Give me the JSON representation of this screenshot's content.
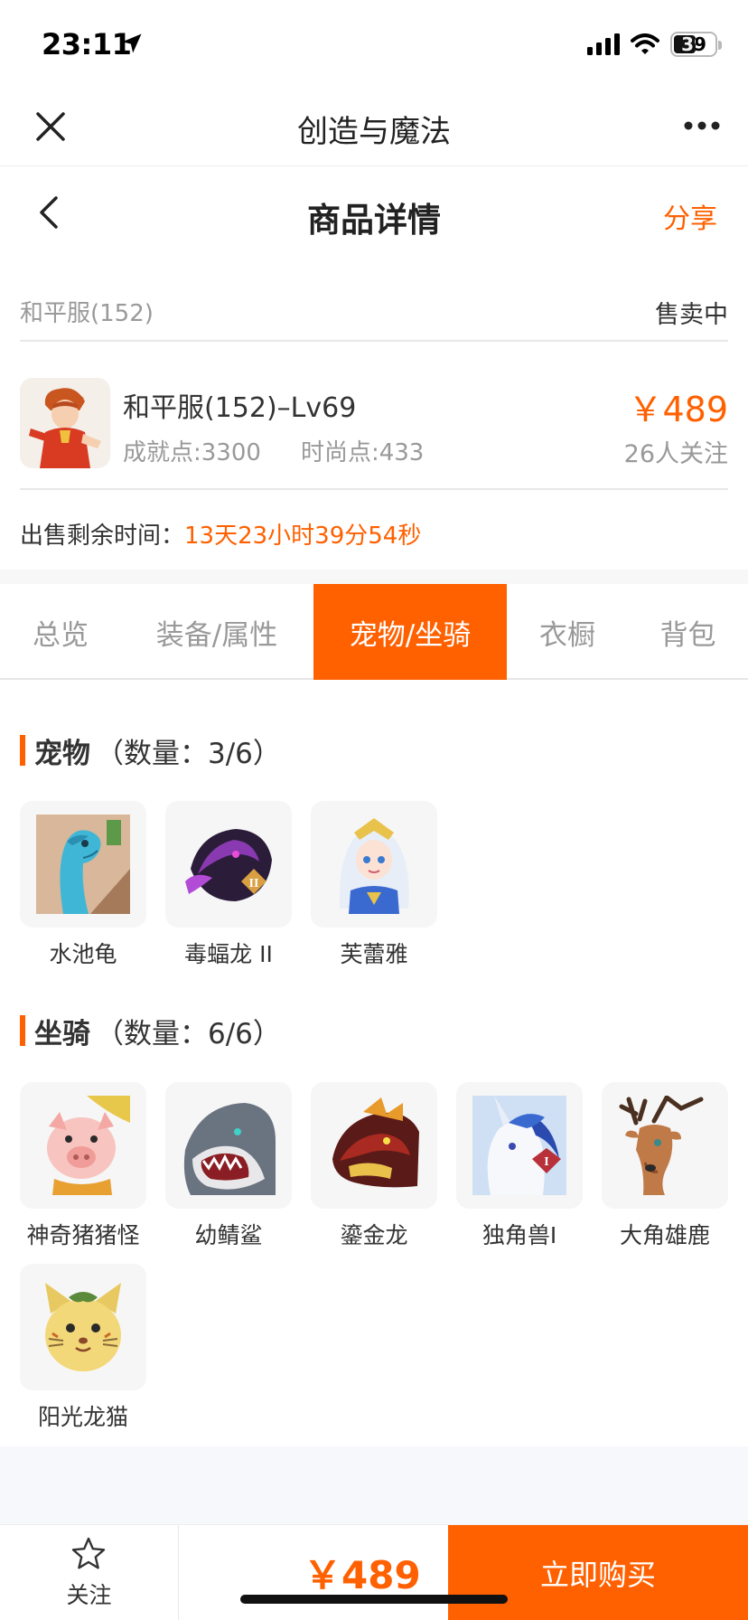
{
  "status_bar": {
    "time": "23:11",
    "battery": "39"
  },
  "app_header": {
    "title": "创造与魔法"
  },
  "page_header": {
    "title": "商品详情",
    "share": "分享"
  },
  "server": {
    "name": "和平服(152)",
    "status": "售卖中"
  },
  "item": {
    "title": "和平服(152)–Lv69",
    "achievement": "成就点:3300",
    "fashion": "时尚点:433",
    "price": "￥489",
    "followers": "26人关注"
  },
  "remaining": {
    "label": "出售剩余时间：",
    "value": "13天23小时39分54秒"
  },
  "tabs": [
    {
      "label": "总览"
    },
    {
      "label": "装备/属性"
    },
    {
      "label": "宠物/坐骑",
      "active": true
    },
    {
      "label": "衣橱"
    },
    {
      "label": "背包"
    }
  ],
  "pets": {
    "title": "宠物",
    "count": "（数量：3/6）",
    "items": [
      {
        "name": "水池龟",
        "icon": "turtle-icon"
      },
      {
        "name": "毒蝠龙 II",
        "icon": "dragon-icon"
      },
      {
        "name": "芙蕾雅",
        "icon": "fairy-icon"
      }
    ]
  },
  "mounts": {
    "title": "坐骑",
    "count": "（数量：6/6）",
    "items": [
      {
        "name": "神奇猪猪怪",
        "icon": "pig-icon"
      },
      {
        "name": "幼鲭鲨",
        "icon": "shark-icon"
      },
      {
        "name": "鎏金龙",
        "icon": "golden-dragon-icon"
      },
      {
        "name": "独角兽I",
        "icon": "unicorn-icon"
      },
      {
        "name": "大角雄鹿",
        "icon": "deer-icon"
      },
      {
        "name": "阳光龙猫",
        "icon": "cat-icon"
      }
    ]
  },
  "bottom_bar": {
    "follow": "关注",
    "price": "￥489",
    "buy": "立即购买"
  },
  "colors": {
    "accent": "#ff6000",
    "muted": "#999999",
    "text": "#333333"
  }
}
